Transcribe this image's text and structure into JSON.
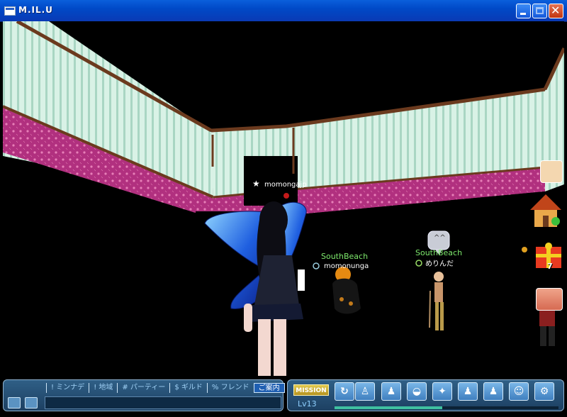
{
  "window": {
    "title": "M.IL.U"
  },
  "players": [
    {
      "name": "momongajp"
    },
    {
      "guild": "SouthBeach",
      "name": "momonunga"
    },
    {
      "guild": "SouthBeach",
      "name": "めりんだ",
      "emote": "^^"
    }
  ],
  "hud": {
    "gift_count": "7"
  },
  "chat": {
    "tabs": [
      "! ミンナデ",
      "! 地域",
      "# パーティー",
      "$ ギルド",
      "% フレンド",
      "ご案内"
    ],
    "active_tab": 5
  },
  "actionbar": {
    "mission_label": "MISSION",
    "level": "Lv13",
    "xp_fraction": 0.48
  },
  "colors": {
    "name_green": "#7de86c",
    "wall_pink": "#b1307f",
    "wall_mint": "#cfeee0",
    "trim_brown": "#6b3a1e"
  }
}
